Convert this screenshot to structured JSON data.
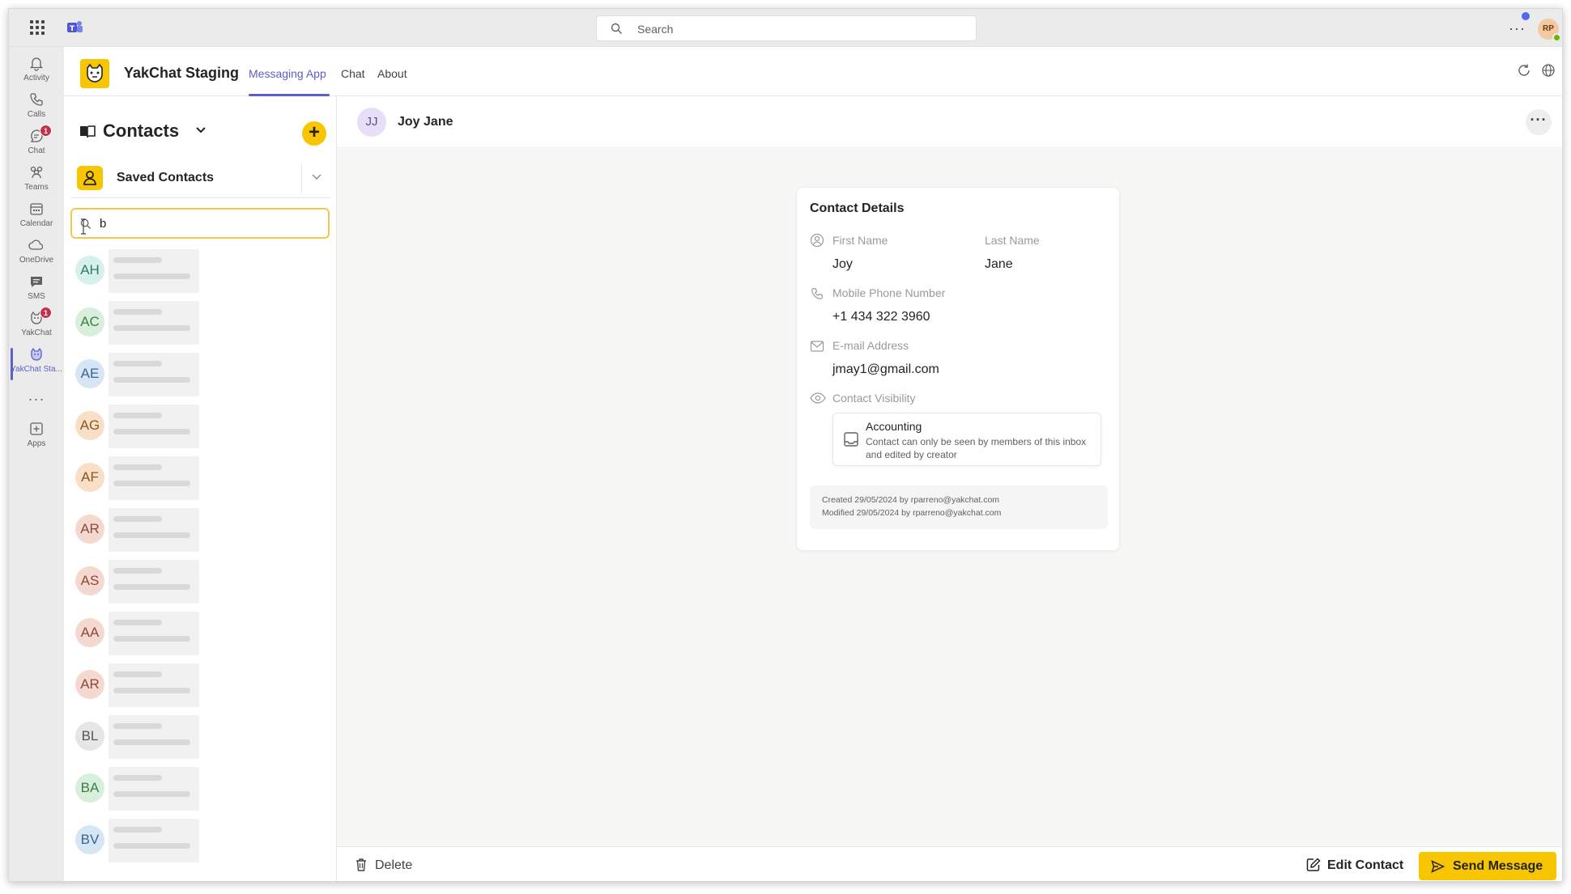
{
  "topbar": {
    "search_placeholder": "Search",
    "user_initials": "RP"
  },
  "rail": [
    {
      "label": "Activity",
      "icon": "bell-icon"
    },
    {
      "label": "Calls",
      "icon": "phone-icon"
    },
    {
      "label": "Chat",
      "icon": "chat-icon",
      "badge": "1"
    },
    {
      "label": "Teams",
      "icon": "teams-icon"
    },
    {
      "label": "Calendar",
      "icon": "calendar-icon"
    },
    {
      "label": "OneDrive",
      "icon": "cloud-icon"
    },
    {
      "label": "SMS",
      "icon": "sms-icon"
    },
    {
      "label": "YakChat",
      "icon": "yakchat-icon",
      "badge": "1"
    },
    {
      "label": "YakChat Sta...",
      "icon": "yakchat-staging-icon",
      "active": true
    },
    {
      "label": "Apps",
      "icon": "apps-icon"
    }
  ],
  "app": {
    "name": "YakChat Staging",
    "tabs": [
      "Messaging App",
      "Chat",
      "About"
    ],
    "active_tab": "Messaging App"
  },
  "contacts_panel": {
    "title": "Contacts",
    "filter_label": "Saved Contacts",
    "search_value": "b",
    "contacts": [
      {
        "initials": "AH",
        "bg": "#d6f0ea",
        "fg": "#2f7a68"
      },
      {
        "initials": "AC",
        "bg": "#d8efdc",
        "fg": "#3d7d4a"
      },
      {
        "initials": "AE",
        "bg": "#d7e6f5",
        "fg": "#3b6591"
      },
      {
        "initials": "AG",
        "bg": "#f8dfc6",
        "fg": "#8a5626"
      },
      {
        "initials": "AF",
        "bg": "#f8dfc6",
        "fg": "#8a5626"
      },
      {
        "initials": "AR",
        "bg": "#f5d9d0",
        "fg": "#8a4a3a"
      },
      {
        "initials": "AS",
        "bg": "#f5d9d0",
        "fg": "#8a4a3a"
      },
      {
        "initials": "AA",
        "bg": "#f5d9d0",
        "fg": "#8a4a3a"
      },
      {
        "initials": "AR",
        "bg": "#f5d9d0",
        "fg": "#8a4a3a"
      },
      {
        "initials": "BL",
        "bg": "#e6e6e6",
        "fg": "#555555"
      },
      {
        "initials": "BA",
        "bg": "#d8efdc",
        "fg": "#3d7d4a"
      },
      {
        "initials": "BV",
        "bg": "#d7e6f5",
        "fg": "#3b6591"
      }
    ]
  },
  "detail": {
    "avatar_initials": "JJ",
    "name": "Joy Jane",
    "card_title": "Contact Details",
    "first_name_label": "First Name",
    "first_name": "Joy",
    "last_name_label": "Last Name",
    "last_name": "Jane",
    "phone_label": "Mobile Phone Number",
    "phone": "+1 434 322 3960",
    "email_label": "E-mail Address",
    "email": "jmay1@gmail.com",
    "visibility_label": "Contact Visibility",
    "visibility_name": "Accounting",
    "visibility_desc": "Contact can only be seen by members of this inbox and edited by creator",
    "created": "Created 29/05/2024 by rparreno@yakchat.com",
    "modified": "Modified 29/05/2024 by rparreno@yakchat.com"
  },
  "footer": {
    "delete_label": "Delete",
    "edit_label": "Edit Contact",
    "send_label": "Send Message"
  },
  "colors": {
    "accent": "#5b5fc7",
    "brand_yellow": "#f7c600",
    "badge_red": "#c4314b"
  }
}
